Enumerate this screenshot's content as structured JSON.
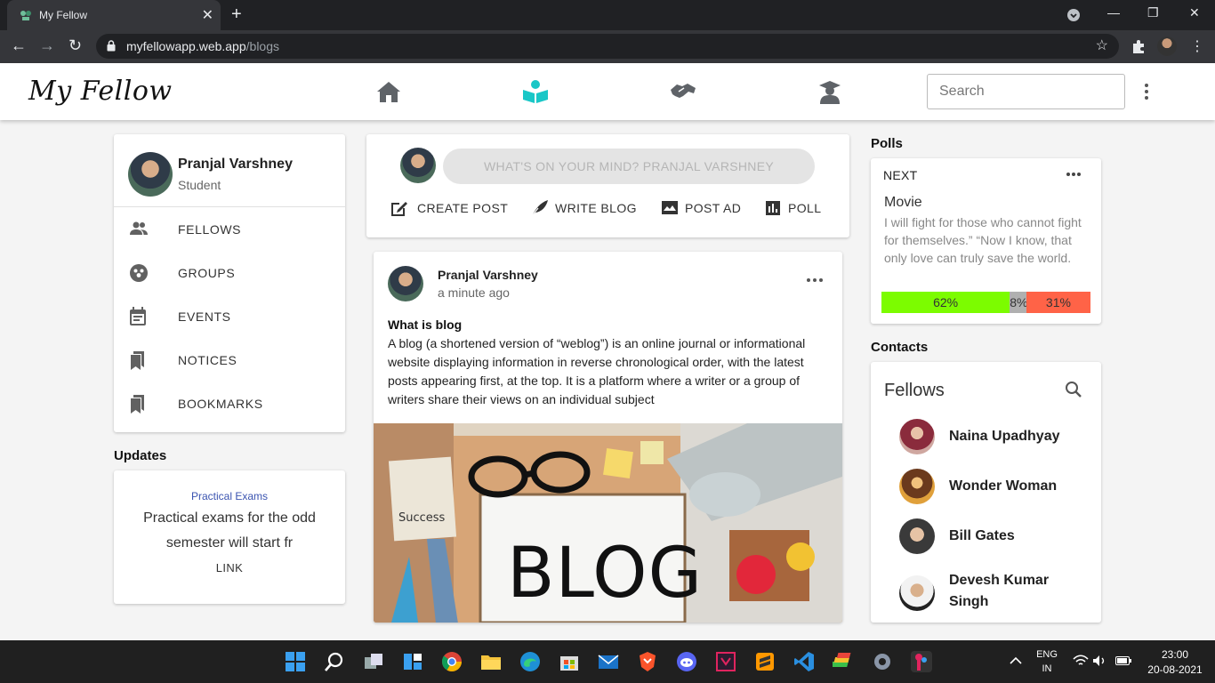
{
  "browser": {
    "tab_title": "My Fellow",
    "url_host": "myfellowapp.web.app",
    "url_path": "/blogs"
  },
  "app": {
    "logo": "My Fellow",
    "search_placeholder": "Search",
    "active_nav": "blogs",
    "accent": "#19c7c7"
  },
  "profile": {
    "name": "Pranjal Varshney",
    "role": "Student",
    "menu": [
      {
        "label": "FELLOWS",
        "icon": "people-icon"
      },
      {
        "label": "GROUPS",
        "icon": "groups-icon"
      },
      {
        "label": "EVENTS",
        "icon": "calendar-icon"
      },
      {
        "label": "NOTICES",
        "icon": "bookmark-icon"
      },
      {
        "label": "BOOKMARKS",
        "icon": "bookmark-icon"
      }
    ]
  },
  "updates": {
    "title": "Updates",
    "heading": "Practical Exams",
    "body": "Practical exams for the odd semester will start fr",
    "link": "LINK"
  },
  "composer": {
    "placeholder": "WHAT'S ON YOUR MIND? PRANJAL VARSHNEY",
    "actions": [
      "CREATE POST",
      "WRITE BLOG",
      "POST AD",
      "POLL"
    ]
  },
  "post": {
    "author": "Pranjal Varshney",
    "time": "a minute ago",
    "title": "What is blog",
    "text": "A blog (a shortened version of “weblog”) is an online journal or informational website displaying information in reverse chronological order, with the latest posts appearing first, at the top. It is a platform where a writer or a group of writers share their views on an individual subject",
    "image_text": "BLOG",
    "image_success": "Success"
  },
  "polls": {
    "title": "Polls",
    "next": "NEXT",
    "poll_title": "Movie",
    "description": "I will fight for those who cannot fight for themselves.” “Now I know, that only love can truly save the world.",
    "results": [
      {
        "label": "62%",
        "value": 62,
        "color": "#7cfc00"
      },
      {
        "label": "8%",
        "value": 8,
        "color": "#b0b0b0"
      },
      {
        "label": "31%",
        "value": 31,
        "color": "#ff6347"
      }
    ]
  },
  "contacts": {
    "title": "Contacts",
    "subtitle": "Fellows",
    "items": [
      "Naina Upadhyay",
      "Wonder Woman",
      "Bill Gates",
      "Devesh Kumar Singh"
    ]
  },
  "taskbar": {
    "lang_top": "ENG",
    "lang_bottom": "IN",
    "time": "23:00",
    "date": "20-08-2021"
  }
}
